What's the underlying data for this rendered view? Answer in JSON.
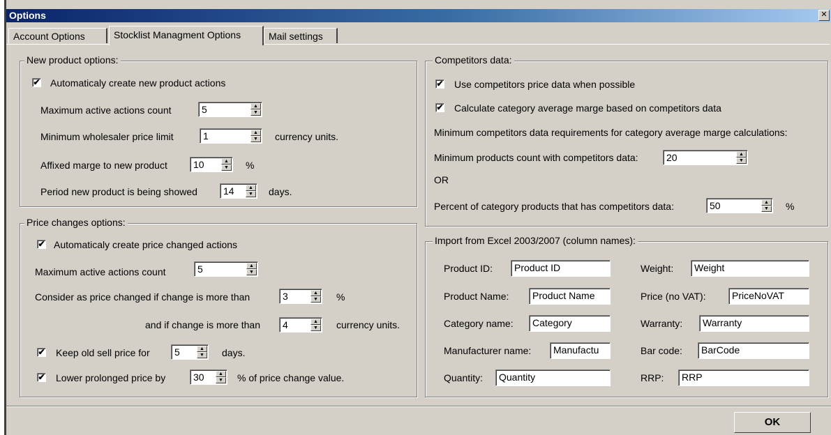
{
  "window": {
    "title": "Options",
    "close_label": "x"
  },
  "tabs": [
    {
      "label": "Account Options"
    },
    {
      "label": "Stocklist Managment Options"
    },
    {
      "label": "Mail settings"
    }
  ],
  "new_product": {
    "legend": "New product options:",
    "auto_create_label": "Automaticaly create new product actions",
    "auto_create_checked": true,
    "max_active_label": "Maximum active actions count",
    "max_active_value": "5",
    "min_wholesaler_label": "Minimum wholesaler price limit",
    "min_wholesaler_value": "1",
    "min_wholesaler_unit": "currency units.",
    "affixed_marge_label": "Affixed marge to new product",
    "affixed_marge_value": "10",
    "affixed_marge_unit": "%",
    "period_label": "Period new product is being showed",
    "period_value": "14",
    "period_unit": "days."
  },
  "price_changes": {
    "legend": "Price changes options:",
    "auto_create_label": "Automaticaly create price changed actions",
    "auto_create_checked": true,
    "max_active_label": "Maximum active actions count",
    "max_active_value": "5",
    "consider_label": "Consider as price changed if change is more than",
    "consider_value": "3",
    "consider_unit": "%",
    "and_if_label": "and if change is more than",
    "and_if_value": "4",
    "and_if_unit": "currency units.",
    "keep_old_label": "Keep old sell price for",
    "keep_old_checked": true,
    "keep_old_value": "5",
    "keep_old_unit": "days.",
    "lower_label": "Lower prolonged price by",
    "lower_checked": true,
    "lower_value": "30",
    "lower_unit": "% of price change value."
  },
  "competitors": {
    "legend": "Competitors data:",
    "use_label": "Use competitors price data when possible",
    "use_checked": true,
    "calc_label": "Calculate category average marge based on competitors data",
    "calc_checked": true,
    "requirements_label": "Minimum competitors data requirements for category average marge calculations:",
    "min_products_label": "Minimum products count with competitors data:",
    "min_products_value": "20",
    "or_label": "OR",
    "percent_label": "Percent of category products that has competitors data:",
    "percent_value": "50",
    "percent_unit": "%"
  },
  "import": {
    "legend": "Import from Excel 2003/2007 (column names):",
    "fields": {
      "product_id": {
        "label": "Product ID:",
        "value": "Product ID"
      },
      "product_name": {
        "label": "Product Name:",
        "value": "Product Name"
      },
      "category_name": {
        "label": "Category name:",
        "value": "Category"
      },
      "manufacturer_name": {
        "label": "Manufacturer name:",
        "value": "Manufactu"
      },
      "quantity": {
        "label": "Quantity:",
        "value": "Quantity"
      },
      "weight": {
        "label": "Weight:",
        "value": "Weight"
      },
      "price_no_vat": {
        "label": "Price (no VAT):",
        "value": "PriceNoVAT"
      },
      "warranty": {
        "label": "Warranty:",
        "value": "Warranty"
      },
      "bar_code": {
        "label": "Bar code:",
        "value": "BarCode"
      },
      "rrp": {
        "label": "RRP:",
        "value": "RRP"
      }
    }
  },
  "footer": {
    "ok_label": "OK"
  },
  "colors": {
    "face": "#d4d0c8",
    "title_start": "#0a246a",
    "title_end": "#a6caf0"
  },
  "icons": {
    "check": "checkmark-icon",
    "spin_up": "spin-up-arrow-icon",
    "spin_down": "spin-down-arrow-icon",
    "close": "close-icon"
  }
}
